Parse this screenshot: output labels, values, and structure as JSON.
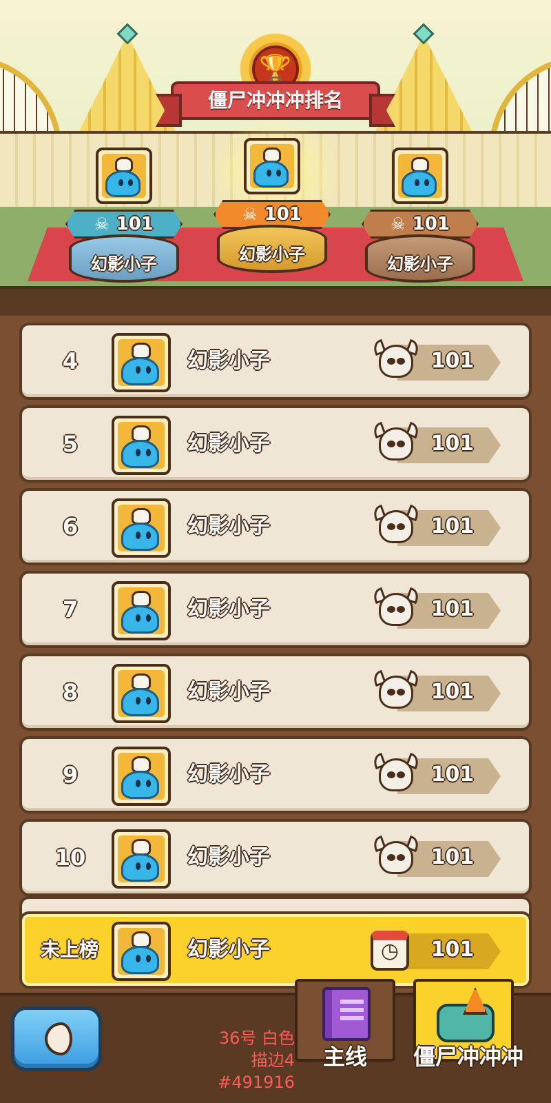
{
  "header": {
    "title": "僵尸冲冲冲排名"
  },
  "podium": [
    {
      "place": 1,
      "name": "幻影小子",
      "score": "101",
      "badge_icon": "skull-icon",
      "color": "#f28a2c"
    },
    {
      "place": 2,
      "name": "幻影小子",
      "score": "101",
      "badge_icon": "skull-icon",
      "color": "#4db0c6"
    },
    {
      "place": 3,
      "name": "幻影小子",
      "score": "101",
      "badge_icon": "skull-icon",
      "color": "#c07e4d"
    }
  ],
  "rows": [
    {
      "rank": "4",
      "name": "幻影小子",
      "score": "101",
      "icon": "horned-skull-icon"
    },
    {
      "rank": "5",
      "name": "幻影小子",
      "score": "101",
      "icon": "horned-skull-icon"
    },
    {
      "rank": "6",
      "name": "幻影小子",
      "score": "101",
      "icon": "horned-skull-icon"
    },
    {
      "rank": "7",
      "name": "幻影小子",
      "score": "101",
      "icon": "horned-skull-icon"
    },
    {
      "rank": "8",
      "name": "幻影小子",
      "score": "101",
      "icon": "horned-skull-icon"
    },
    {
      "rank": "9",
      "name": "幻影小子",
      "score": "101",
      "icon": "horned-skull-icon"
    },
    {
      "rank": "10",
      "name": "幻影小子",
      "score": "101",
      "icon": "horned-skull-icon"
    }
  ],
  "self_row": {
    "rank": "未上榜",
    "name": "幻影小子",
    "score": "101",
    "icon": "calendar-clock-icon",
    "color": "#fbd12c"
  },
  "note": {
    "line1": "36号  白色",
    "line2": "描边4  #491916"
  },
  "bottom_nav": {
    "back_icon": "back-arrow-icon",
    "tabs": [
      {
        "label": "主线",
        "icon": "book-icon",
        "active": false
      },
      {
        "label": "僵尸冲冲冲",
        "icon": "zombie-cone-icon",
        "active": true
      }
    ]
  }
}
